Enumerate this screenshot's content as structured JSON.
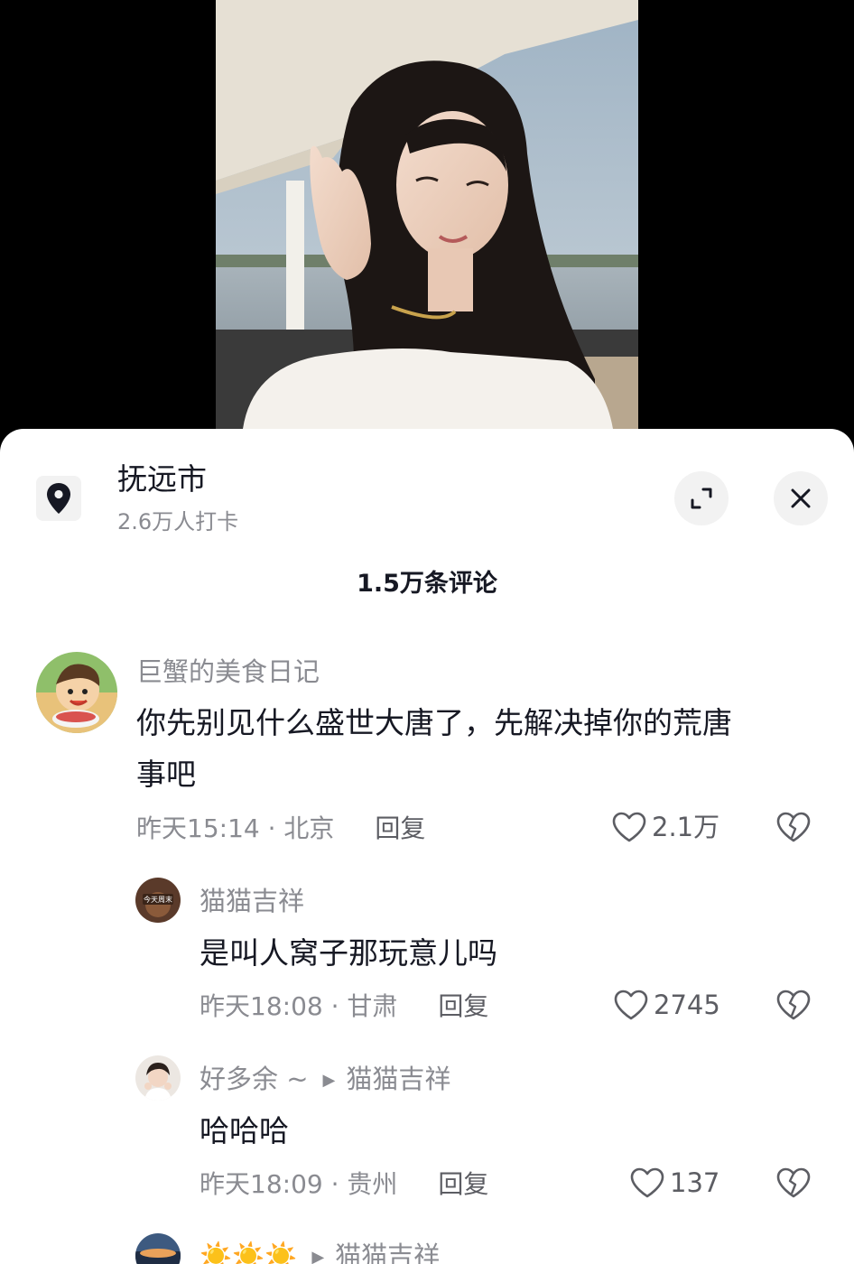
{
  "location": {
    "name": "抚远市",
    "checkins": "2.6万人打卡"
  },
  "comments_header": "1.5万条评论",
  "comments": [
    {
      "user": "巨蟹的美食日记",
      "text_line1": "你先别见什么盛世大唐了，先解决掉你的荒唐",
      "text_line2": "事吧",
      "time": "昨天15:14",
      "location": "北京",
      "reply_label": "回复",
      "likes": "2.1万"
    },
    {
      "user": "猫猫吉祥",
      "avatar_text": "今天周末",
      "text": "是叫人窝子那玩意儿吗",
      "time": "昨天18:08",
      "location": "甘肃",
      "reply_label": "回复",
      "likes": "2745"
    },
    {
      "user": "好多余 ~",
      "reply_to": "猫猫吉祥",
      "text": "哈哈哈",
      "time": "昨天18:09",
      "location": "贵州",
      "reply_label": "回复",
      "likes": "137"
    },
    {
      "user": "☀️☀️☀️",
      "reply_to": "猫猫吉祥"
    }
  ],
  "colors": {
    "text_primary": "#161823",
    "text_secondary": "#8a8b91",
    "sheet_bg": "#ffffff",
    "button_bg": "#f2f2f2"
  },
  "icons": [
    "location-pin-icon",
    "expand-icon",
    "close-icon",
    "heart-icon",
    "broken-heart-icon",
    "reply-arrow-icon"
  ]
}
